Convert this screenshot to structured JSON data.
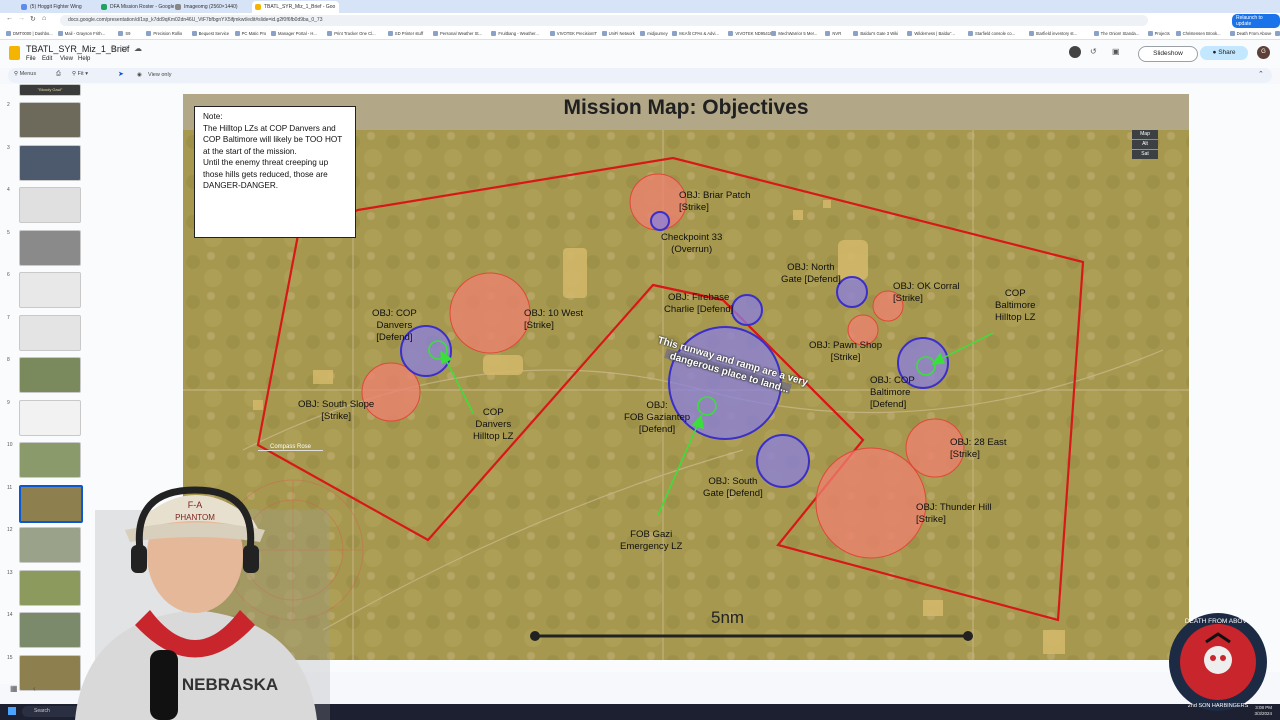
{
  "browser": {
    "tabs": [
      {
        "label": "(5) Hoggit Fighter Wing"
      },
      {
        "label": "DFA Mission Roster - Google S"
      },
      {
        "label": "Imageomg (2560×1440)"
      },
      {
        "label": "TBATL_SYR_Miz_1_Brief - Goo"
      }
    ],
    "url": "docs.google.com/presentation/d/1sp_k7dd9qKm02dn46U_VtF7bfbgnYX5ifjmkwt/edit#slide=id.g2f0f6fb0d9ba_0_73",
    "bookmarks": [
      "DMT0000 | Dashbo...",
      "Mail - Grayson Frith...",
      "S9",
      "Precision Rollio",
      "Bequest Service",
      "PC Matic Pro",
      "Manager Portal - H...",
      "Print Tracker One Cl...",
      "SD Printer stuff",
      "Personal Weather St...",
      "Fruitbang - Weather...",
      "VIVOTEK PrecisionIT",
      "UniFi Network",
      "midjourney",
      "McAfit CPAs & Advi...",
      "VIVOTEK ND9541P",
      "MechWarrior 5 Mer...",
      "NVR",
      "Baldur's Gate 3 Wiki",
      "Wilderness | Baldur'...",
      "Starfield console co...",
      "Starfield inventory st...",
      "The Onion! Standa...",
      "Projects",
      "Christensen Brook...",
      "Death From Above",
      "Wind Map",
      "All Bookmarks"
    ],
    "relaunch": "Relaunch to update"
  },
  "doc": {
    "title": "TBATL_SYR_Miz_1_Brief",
    "menus": [
      "File",
      "Edit",
      "View",
      "Help"
    ],
    "slideshow_label": "Slideshow",
    "share_label": "Share",
    "avatar_letter": "G"
  },
  "toolbar": {
    "search_label": "Menus",
    "zoom_label": "Fit",
    "view_only_label": "View only"
  },
  "filmstrip": {
    "first_label": "\"Bloody Gaul\"",
    "slide_numbers": [
      "2",
      "3",
      "4",
      "5",
      "6",
      "7",
      "8",
      "9",
      "10",
      "11",
      "12",
      "13",
      "14",
      "15"
    ],
    "selected": "11"
  },
  "slide": {
    "title": "Mission Map: Objectives",
    "note_lines": [
      "Note:",
      "The Hilltop LZs at COP Danvers and COP Baltimore will likely be TOO HOT at the start of the mission.",
      "",
      "Until the enemy threat creeping up those hills gets reduced, those are DANGER-DANGER."
    ],
    "map_types": [
      "Map",
      "Alt",
      "Sat"
    ],
    "runway_note": [
      "This runway and ramp are a very",
      "dangerous place to land..."
    ],
    "scale_label": "5nm",
    "compass_label": "Compass Rose",
    "labels": [
      {
        "id": "briar",
        "lines": [
          "OBJ: Briar Patch",
          "[Strike]"
        ]
      },
      {
        "id": "checkpoint",
        "lines": [
          "Checkpoint 33",
          "(Overrun)"
        ]
      },
      {
        "id": "north-gate",
        "lines": [
          "OBJ: North",
          "Gate [Defend]"
        ]
      },
      {
        "id": "ok-corral",
        "lines": [
          "OBJ: OK Corral",
          "[Strike]"
        ]
      },
      {
        "id": "cop-baltimore-lz",
        "lines": [
          "COP",
          "Baltimore",
          "Hilltop LZ"
        ]
      },
      {
        "id": "firebase",
        "lines": [
          "OBJ: Firebase",
          "Charlie [Defend]"
        ]
      },
      {
        "id": "cop-danvers",
        "lines": [
          "OBJ: COP",
          "Danvers",
          "[Defend]"
        ]
      },
      {
        "id": "ten-west",
        "lines": [
          "OBJ: 10 West",
          "[Strike]"
        ]
      },
      {
        "id": "pawn-shop",
        "lines": [
          "OBJ: Pawn Shop",
          "[Strike]"
        ]
      },
      {
        "id": "cop-baltimore",
        "lines": [
          "OBJ: COP",
          "Baltimore",
          "[Defend]"
        ]
      },
      {
        "id": "south-slope",
        "lines": [
          "OBJ: South Slope",
          "[Strike]"
        ]
      },
      {
        "id": "cop-danvers-lz",
        "lines": [
          "COP",
          "Danvers",
          "Hilltop LZ"
        ]
      },
      {
        "id": "fob-gaziantep",
        "lines": [
          "OBJ:",
          "FOB Gaziantep",
          "[Defend]"
        ]
      },
      {
        "id": "twenty-eight-east",
        "lines": [
          "OBJ: 28 East",
          "[Strike]"
        ]
      },
      {
        "id": "south-gate",
        "lines": [
          "OBJ: South",
          "Gate [Defend]"
        ]
      },
      {
        "id": "thunder-hill",
        "lines": [
          "OBJ: Thunder Hill",
          "[Strike]"
        ]
      },
      {
        "id": "fob-gazi-lz",
        "lines": [
          "FOB Gazi",
          "Emergency LZ"
        ]
      }
    ]
  },
  "taskbar": {
    "search_placeholder": "Search",
    "time": "3:08 PM",
    "date": "3/3/2024"
  },
  "overlay": {
    "cap_text": "F-A",
    "cap_text2": "PHANTOM",
    "shirt_text": "NEBRASKA",
    "logo_top": "DEATH FROM ABOVE",
    "logo_bottom": "2nd SON HARBINGERS"
  },
  "colors": {
    "strike_fill": "#f08070",
    "defend_fill": "#8a7fe0",
    "zone_border": "#d81818",
    "lz_arrow": "#3ae03a",
    "share_bg": "#c2e7ff",
    "selected_border": "#0b57d0"
  }
}
